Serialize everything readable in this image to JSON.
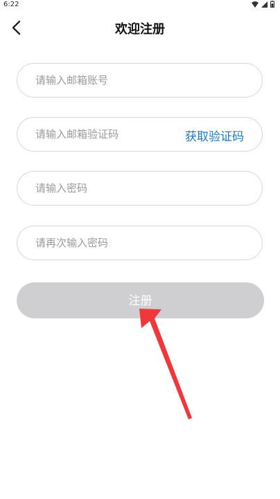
{
  "status": {
    "time": "6:22"
  },
  "header": {
    "title": "欢迎注册"
  },
  "form": {
    "email_placeholder": "请输入邮箱账号",
    "code_placeholder": "请输入邮箱验证码",
    "get_code_label": "获取验证码",
    "password_placeholder": "请输入密码",
    "confirm_placeholder": "请再次输入密码",
    "submit_label": "注册"
  },
  "colors": {
    "accent": "#1f79c7",
    "button_disabled": "#cfcfd1",
    "annotation_arrow": "#f0373c"
  },
  "icons": [
    "wifi-icon",
    "signal-icon",
    "battery-icon",
    "back-arrow-icon"
  ]
}
